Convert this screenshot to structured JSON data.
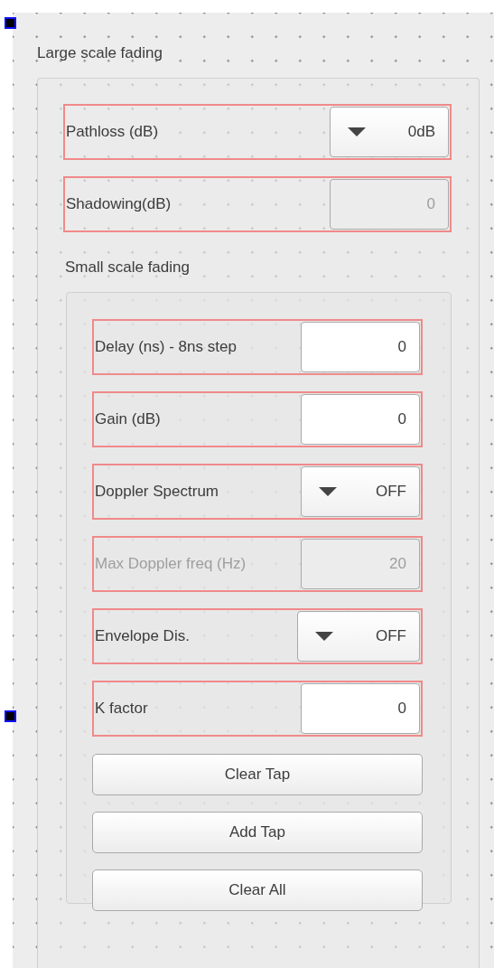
{
  "large_scale": {
    "title": "Large scale fading",
    "rows": [
      {
        "kind": "combo",
        "label": "Pathloss (dB)",
        "value": "0dB",
        "disabled": false,
        "label_disabled": false
      },
      {
        "kind": "spin",
        "label": "Shadowing(dB)",
        "value": "0",
        "disabled": true,
        "label_disabled": false
      }
    ]
  },
  "small_scale": {
    "title": "Small scale fading",
    "rows": [
      {
        "kind": "spin",
        "label": "Delay (ns) - 8ns step",
        "value": "0",
        "disabled": false,
        "label_disabled": false
      },
      {
        "kind": "spin",
        "label": "Gain (dB)",
        "value": "0",
        "disabled": false,
        "label_disabled": false
      },
      {
        "kind": "combo",
        "label": "Doppler Spectrum",
        "value": "OFF",
        "disabled": false,
        "label_disabled": false
      },
      {
        "kind": "spin",
        "label": "Max Doppler freq (Hz)",
        "value": "20",
        "disabled": true,
        "label_disabled": true
      },
      {
        "kind": "combo",
        "label": "Envelope Dis.",
        "value": "OFF",
        "disabled": false,
        "label_disabled": false
      },
      {
        "kind": "spin",
        "label": "K factor",
        "value": "0",
        "disabled": false,
        "label_disabled": false
      }
    ],
    "buttons": [
      "Clear Tap",
      "Add Tap",
      "Clear All"
    ]
  }
}
